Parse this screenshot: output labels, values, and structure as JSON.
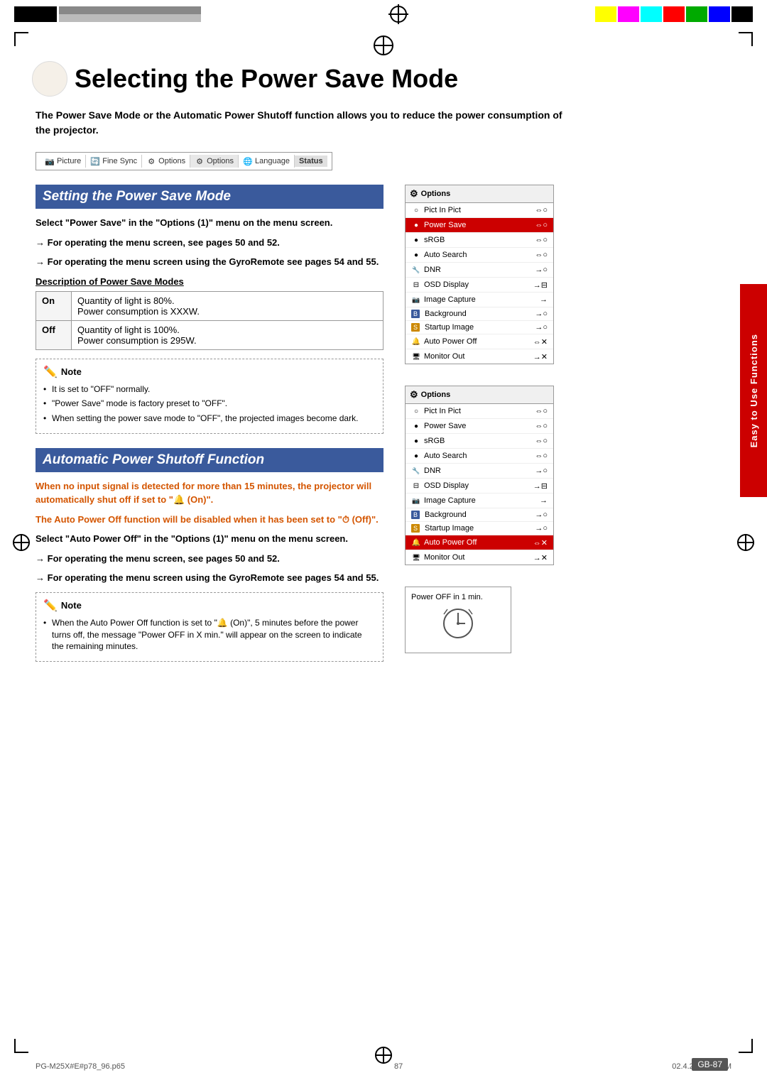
{
  "page": {
    "title": "Selecting the Power Save Mode",
    "number": "GB-87",
    "footer_left": "PG-M25X#E#p78_96.p65",
    "footer_center": "87",
    "footer_right": "02.4.29, 3:21 PM"
  },
  "intro": {
    "text": "The Power Save Mode or the Automatic Power Shutoff function allows you to reduce the power consumption of the projector."
  },
  "menu_bar": {
    "items": [
      {
        "icon": "📷",
        "label": "Picture"
      },
      {
        "icon": "🔄",
        "label": "Fine Sync"
      },
      {
        "icon": "⚙",
        "label": "Options"
      },
      {
        "icon": "⚙",
        "label": "Options",
        "highlighted": true
      },
      {
        "icon": "🌐",
        "label": "Language"
      },
      {
        "icon": "",
        "label": "Status",
        "status": true
      }
    ]
  },
  "section1": {
    "heading": "Setting the Power Save Mode",
    "step1": "Select \"Power Save\" in the \"Options (1)\" menu on the menu screen.",
    "arrow1": "For operating the menu screen, see pages 50 and 52.",
    "arrow2": "For operating the menu screen using the GyroRemote see pages 54 and 55.",
    "desc_heading": "Description of Power Save Modes",
    "table": [
      {
        "label": "On",
        "line1": "Quantity of light is 80%.",
        "line2": "Power consumption is XXXW."
      },
      {
        "label": "Off",
        "line1": "Quantity of light is 100%.",
        "line2": "Power consumption is 295W."
      }
    ],
    "note_title": "Note",
    "notes": [
      "It is set to \"OFF\" normally.",
      "\"Power Save\" mode is factory preset to \"OFF\".",
      "When setting the power save mode to \"OFF\", the projected images become dark."
    ]
  },
  "section2": {
    "heading": "Automatic Power Shutoff Function",
    "orange_line1": "When no input signal is detected for more than 15 minutes, the projector will automatically shut off if set to \"",
    "orange_icon": "🔔",
    "orange_line1_end": " (On)\".",
    "orange_line2": "The Auto Power Off function will be disabled when it has been set to \"",
    "orange_icon2": "⏱",
    "orange_line2_end": " (Off)\".",
    "step1": "Select \"Auto Power Off\" in the \"Options (1)\" menu on the menu screen.",
    "arrow1": "For operating the menu screen, see pages 50 and 52.",
    "arrow2": "For operating the menu screen using the GyroRemote see pages 54 and 55.",
    "note_title": "Note",
    "notes": [
      "When the Auto Power Off function is set to \" (On)\", 5 minutes before the power turns off, the message \"Power OFF in X min.\" will appear on the screen to indicate the remaining minutes."
    ],
    "power_off_label": "Power OFF in 1 min."
  },
  "options_panel1": {
    "title": "Options",
    "rows": [
      {
        "label": "Pict In Pict",
        "icon": "○",
        "controls": "⇔○"
      },
      {
        "label": "Power Save",
        "icon": "●",
        "controls": "⇔○",
        "highlighted": true
      },
      {
        "label": "sRGB",
        "icon": "●",
        "controls": "⇔○"
      },
      {
        "label": "Auto Search",
        "icon": "●",
        "controls": "⇔○"
      },
      {
        "label": "DNR",
        "icon": "🔧",
        "controls": "→○"
      },
      {
        "label": "OSD Display",
        "icon": "⊟",
        "controls": "→⊟"
      },
      {
        "label": "Image Capture",
        "icon": "📷",
        "controls": "→"
      },
      {
        "label": "Background",
        "icon": "B",
        "controls": "→○"
      },
      {
        "label": "Startup Image",
        "icon": "S",
        "controls": "→○"
      },
      {
        "label": "Auto Power Off",
        "icon": "🔔",
        "controls": "⇔✕"
      },
      {
        "label": "Monitor Out",
        "icon": "🖥",
        "controls": "→✕"
      }
    ]
  },
  "options_panel2": {
    "title": "Options",
    "rows": [
      {
        "label": "Pict In Pict",
        "icon": "○",
        "controls": "⇔○"
      },
      {
        "label": "Power Save",
        "icon": "●",
        "controls": "⇔○"
      },
      {
        "label": "sRGB",
        "icon": "●",
        "controls": "⇔○"
      },
      {
        "label": "Auto Search",
        "icon": "●",
        "controls": "⇔○"
      },
      {
        "label": "DNR",
        "icon": "🔧",
        "controls": "→○"
      },
      {
        "label": "OSD Display",
        "icon": "⊟",
        "controls": "→⊟"
      },
      {
        "label": "Image Capture",
        "icon": "📷",
        "controls": "→"
      },
      {
        "label": "Background",
        "icon": "B",
        "controls": "→○"
      },
      {
        "label": "Startup Image",
        "icon": "S",
        "controls": "→○"
      },
      {
        "label": "Auto Power Off",
        "icon": "🔔",
        "controls": "⇔✕",
        "highlighted": true
      },
      {
        "label": "Monitor Out",
        "icon": "🖥",
        "controls": "→✕"
      }
    ]
  },
  "sidebar": {
    "text": "Easy to Use Functions"
  }
}
